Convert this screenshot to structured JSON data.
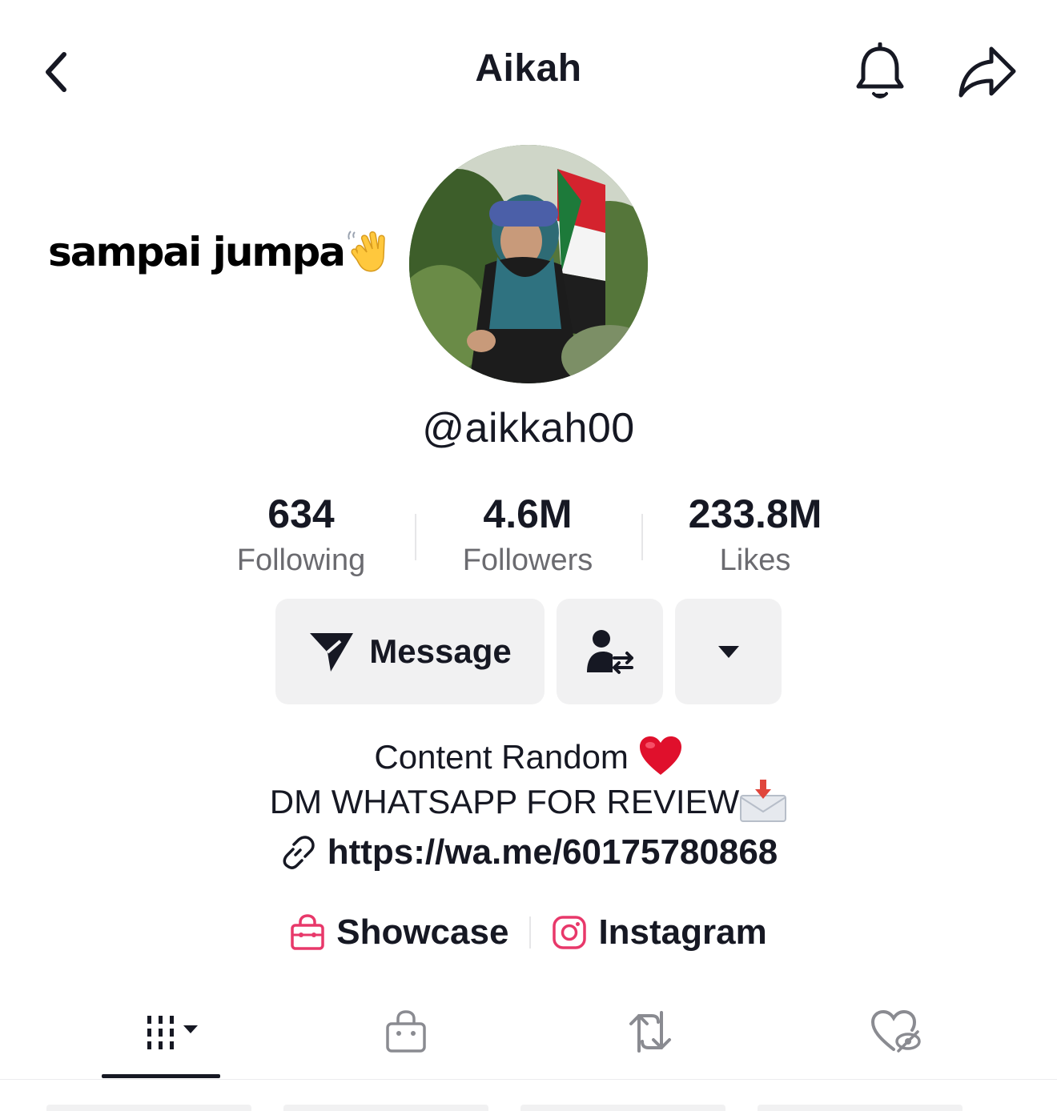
{
  "header": {
    "title": "Aikah",
    "icons": [
      "chevron-left-icon",
      "bell-icon",
      "share-icon"
    ]
  },
  "sticker": {
    "text": "sampai jumpa",
    "emoji": "waving-hand"
  },
  "profile": {
    "username": "@aikkah00"
  },
  "stats": [
    {
      "value": "634",
      "label": "Following"
    },
    {
      "value": "4.6M",
      "label": "Followers"
    },
    {
      "value": "233.8M",
      "label": "Likes"
    }
  ],
  "actions": {
    "message_label": "Message"
  },
  "bio": {
    "line1": "Content Random",
    "line2": "DM WHATSAPP FOR REVIEW",
    "link": "https://wa.me/60175780868"
  },
  "extra_links": {
    "showcase": "Showcase",
    "instagram": "Instagram"
  },
  "tabs": [
    "videos-grid",
    "showcase",
    "reposts",
    "liked-private"
  ],
  "colors": {
    "text": "#161823",
    "muted": "#6b6b70",
    "button_bg": "#f1f1f2",
    "pink_accent": "#e8386a",
    "heart_red": "#e0102c"
  }
}
